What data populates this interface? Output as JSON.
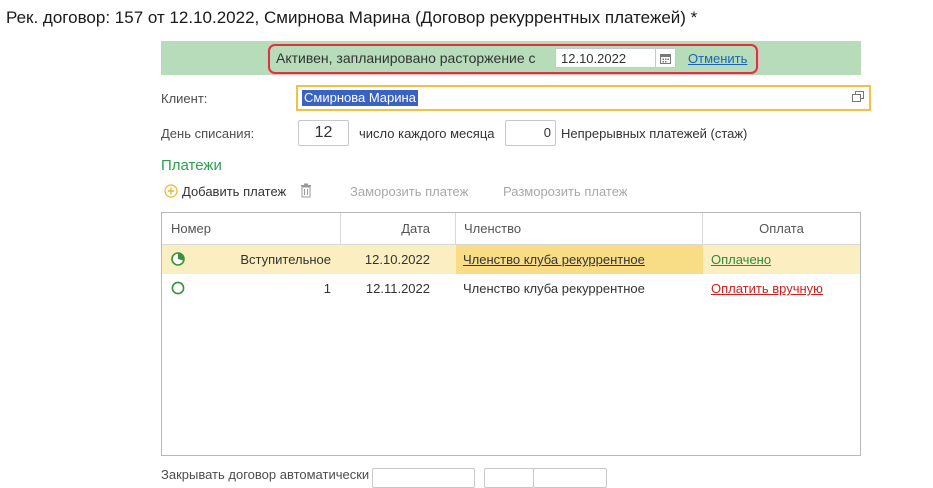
{
  "window": {
    "title": "Рек. договор: 157 от 12.10.2022, Смирнова Марина (Договор рекуррентных платежей) *"
  },
  "banner": {
    "status_text": "Активен, запланировано расторжение с",
    "date_value": "12.10.2022",
    "cancel_label": "Отменить",
    "background_color": "#b6dcb9",
    "highlight_color": "#d8363f"
  },
  "client": {
    "label": "Клиент:",
    "value": "Смирнова Марина"
  },
  "debit": {
    "label": "День списания:",
    "day_value": "12",
    "day_suffix": "число каждого месяца",
    "streak_value": "0",
    "streak_label": "Непрерывных платежей (стаж)"
  },
  "payments": {
    "section_title": "Платежи",
    "toolbar": {
      "add_label": "Добавить платеж",
      "freeze_label": "Заморозить платеж",
      "unfreeze_label": "Разморозить платеж"
    },
    "columns": [
      "Номер",
      "Дата",
      "Членство",
      "Оплата"
    ],
    "rows": [
      {
        "number": "Вступительное",
        "date": "12.10.2022",
        "membership": "Членство клуба рекуррентное",
        "payment": "Оплачено",
        "status_icon": "clock-circle-icon"
      },
      {
        "number": "1",
        "date": "12.11.2022",
        "membership": "Членство клуба рекуррентное",
        "payment": "Оплатить вручную",
        "status_icon": "circle-outline-icon"
      }
    ]
  },
  "auto_close": {
    "label": "Закрывать договор автоматически"
  },
  "colors": {
    "accent_green": "#2e9e4f",
    "selection": "#fbefc1",
    "link_blue": "#1a64b8",
    "link_red": "#d02020"
  }
}
